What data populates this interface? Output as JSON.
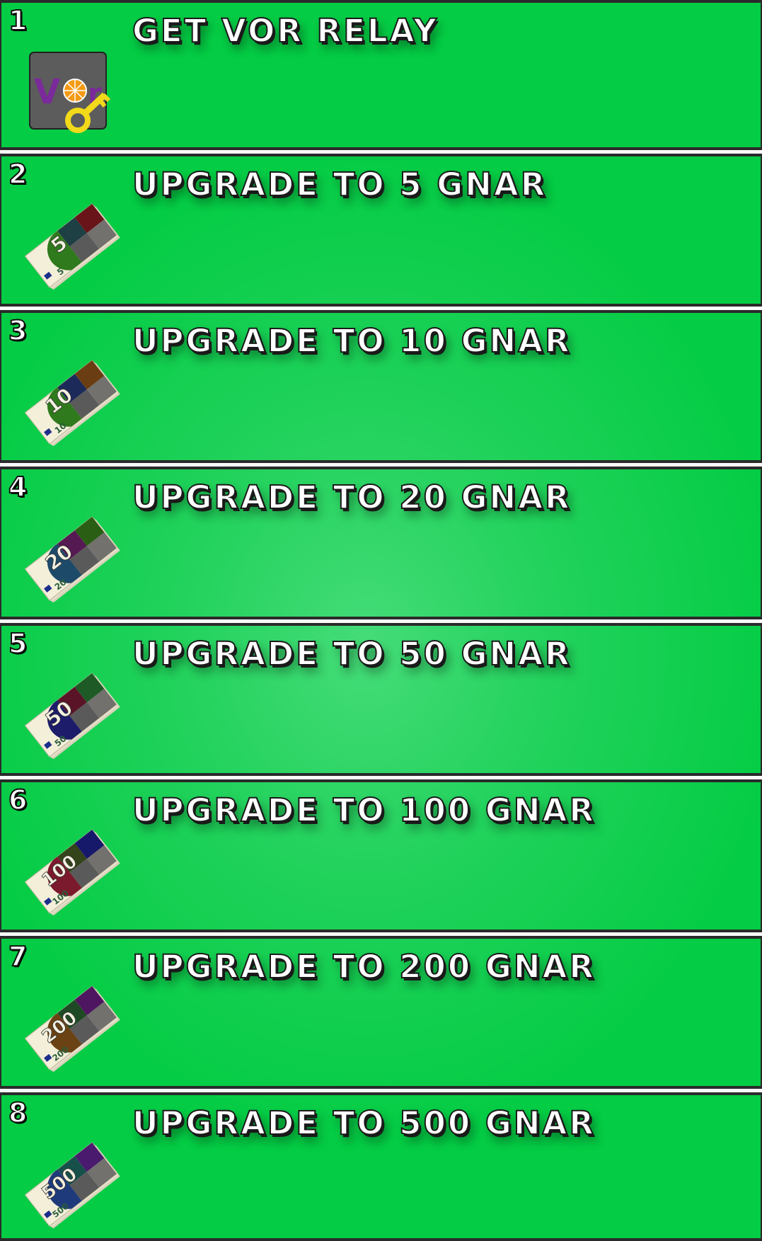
{
  "steps": [
    {
      "number": "1",
      "title": "GET VOR RELAY",
      "icon": "vor-relay-key-icon"
    },
    {
      "number": "2",
      "title": "UPGRADE TO 5 GNAR",
      "icon": "banknote-5-icon",
      "note_value": "5",
      "colors": [
        "#1e3f43",
        "#681418",
        "#2f7a1c",
        "#5a5a5a"
      ]
    },
    {
      "number": "3",
      "title": "UPGRADE TO 10 GNAR",
      "icon": "banknote-10-icon",
      "note_value": "10",
      "colors": [
        "#1c2a5a",
        "#6a3e12",
        "#2f7a1c",
        "#5a5a5a"
      ]
    },
    {
      "number": "4",
      "title": "UPGRADE TO 20 GNAR",
      "icon": "banknote-20-icon",
      "note_value": "20",
      "colors": [
        "#551a52",
        "#2a5e14",
        "#1e4a6a",
        "#5a5a5a"
      ]
    },
    {
      "number": "5",
      "title": "UPGRADE TO 50 GNAR",
      "icon": "banknote-50-icon",
      "note_value": "50",
      "colors": [
        "#5a1428",
        "#1d5a26",
        "#1c1c6a",
        "#5a5a5a"
      ]
    },
    {
      "number": "6",
      "title": "UPGRADE TO 100 GNAR",
      "icon": "banknote-100-icon",
      "note_value": "100",
      "colors": [
        "#33431a",
        "#16186a",
        "#7a1a2c",
        "#5a5a5a"
      ]
    },
    {
      "number": "7",
      "title": "UPGRADE TO 200 GNAR",
      "icon": "banknote-200-icon",
      "note_value": "200",
      "colors": [
        "#1d4a24",
        "#4e1660",
        "#6a4214",
        "#5a5a5a"
      ]
    },
    {
      "number": "8",
      "title": "UPGRADE TO 500 GNAR",
      "icon": "banknote-500-icon",
      "note_value": "500",
      "colors": [
        "#17504a",
        "#4a1a6e",
        "#1e3a7a",
        "#5a5a5a"
      ]
    }
  ]
}
